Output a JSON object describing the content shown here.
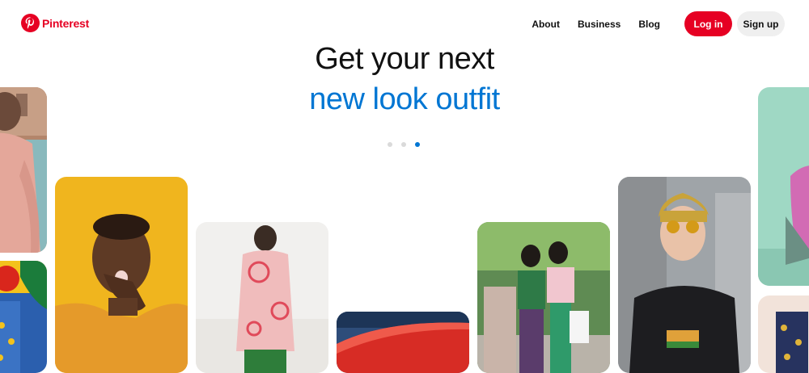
{
  "brand": {
    "name": "Pinterest",
    "color": "#e60023"
  },
  "nav": {
    "links": [
      "About",
      "Business",
      "Blog"
    ],
    "login_label": "Log in",
    "signup_label": "Sign up"
  },
  "hero": {
    "line1": "Get your next",
    "line2": "new look outfit",
    "line2_color": "#0076d3",
    "carousel": {
      "total": 3,
      "active_index": 2
    }
  },
  "pins": [
    {
      "name": "pin-man-pink-sweater",
      "icon": "photo"
    },
    {
      "name": "pin-colorful-fabric",
      "icon": "photo"
    },
    {
      "name": "pin-man-yellow-background",
      "icon": "photo"
    },
    {
      "name": "pin-woman-pink-jacket",
      "icon": "photo"
    },
    {
      "name": "pin-red-fabric",
      "icon": "photo"
    },
    {
      "name": "pin-two-women-street",
      "icon": "photo"
    },
    {
      "name": "pin-woman-yellow-turban",
      "icon": "photo"
    },
    {
      "name": "pin-mint-wall",
      "icon": "photo"
    },
    {
      "name": "pin-floral-print",
      "icon": "photo"
    }
  ]
}
